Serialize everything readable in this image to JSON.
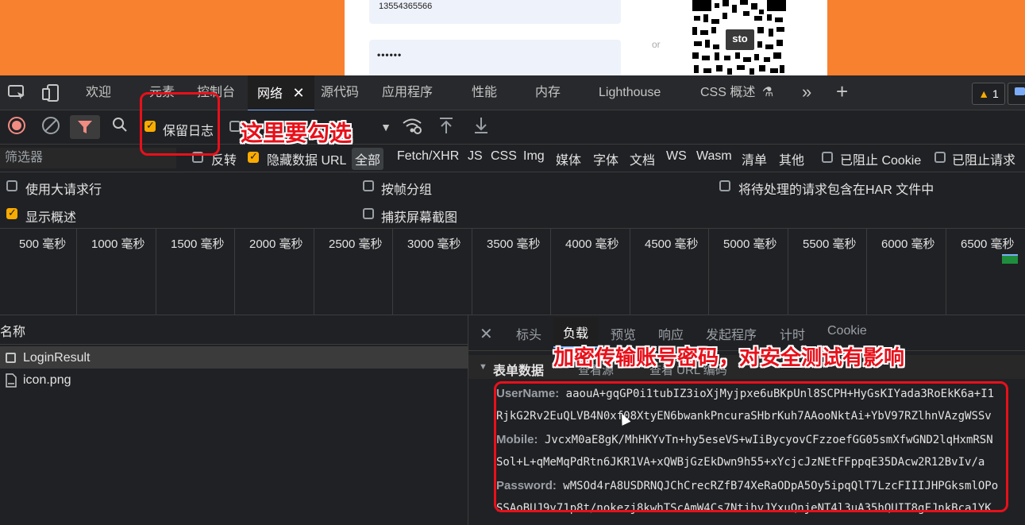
{
  "page": {
    "phone_value": "13554365566",
    "password_mask": "••••••",
    "or_label": "or",
    "logo_text": "sto"
  },
  "tabs": [
    {
      "label": "欢迎"
    },
    {
      "label": "元素"
    },
    {
      "label": "控制台"
    },
    {
      "label": "网络",
      "active": true
    },
    {
      "label": "源代码"
    },
    {
      "label": "应用程序"
    },
    {
      "label": "性能"
    },
    {
      "label": "内存"
    },
    {
      "label": "Lighthouse"
    },
    {
      "label": "CSS 概述"
    }
  ],
  "warning_count": "1",
  "toolbar": {
    "preserve_log_label": "保留日志",
    "preserve_log_checked": true
  },
  "filter": {
    "placeholder": "筛选器",
    "invert_label": "反转",
    "hide_data_url_label": "隐藏数据 URL",
    "hide_data_url_checked": true,
    "types": [
      "全部",
      "Fetch/XHR",
      "JS",
      "CSS",
      "Img",
      "媒体",
      "字体",
      "文档",
      "WS",
      "Wasm",
      "清单",
      "其他"
    ],
    "active_type": "全部",
    "blocked_cookies_label": "已阻止 Cookie",
    "blocked_requests_label": "已阻止请求"
  },
  "options": {
    "large_rows": "使用大请求行",
    "group_by_frame": "按帧分组",
    "har_pending": "将待处理的请求包含在HAR 文件中",
    "show_overview": "显示概述",
    "show_overview_checked": true,
    "capture_screenshots": "捕获屏幕截图"
  },
  "timeline": {
    "ticks": [
      "500 毫秒",
      "1000 毫秒",
      "1500 毫秒",
      "2000 毫秒",
      "2500 毫秒",
      "3000 毫秒",
      "3500 毫秒",
      "4000 毫秒",
      "4500 毫秒",
      "5000 毫秒",
      "5500 毫秒",
      "6000 毫秒",
      "6500 毫秒"
    ]
  },
  "requests": {
    "header": "名称",
    "items": [
      {
        "name": "LoginResult",
        "selected": true
      },
      {
        "name": "icon.png",
        "selected": false
      }
    ]
  },
  "details": {
    "tabs": [
      "标头",
      "负载",
      "预览",
      "响应",
      "发起程序",
      "计时",
      "Cookie"
    ],
    "active_tab": "负载",
    "section_title": "表单数据",
    "view_source": "查看源",
    "view_url_encoded": "查看 URL 编码",
    "fields": [
      {
        "key": "UserName:",
        "value": "aaouA+gqGP0i1tubIZ3ioXjMyjpxe6uBKpUnl8SCPH+HyGsKIYada3RoEkK6a+I1"
      },
      {
        "key": "",
        "value": "RjkG2Rv2EuQLVB4N0xf08XtyEN6bwankPncuraSHbrKuh7AAooNktAi+YbV97RZlhnVAzgWSSv"
      },
      {
        "key": "Mobile:",
        "value": "JvcxM0aE8gK/MhHKYvTn+hy5eseVS+wIiBycyovCFzzoefGG05smXfwGND2lqHxmRSN"
      },
      {
        "key": "",
        "value": "Sol+L+qMeMqPdRtn6JKR1VA+xQWBjGzEkDwn9h55+xYcjcJzNEtFFppqE35DAcw2R12BvIv/a"
      },
      {
        "key": "Password:",
        "value": "wMSOd4rA8USDRNQJChCrecRZfB74XeRaODpA5Oy5ipqQlT7LzcFIIIJHPGksmlOPo"
      },
      {
        "key": "",
        "value": "SSAoBUJ9v71p8t/nokezj8kwhTScAmW4Cs7NtihvJYxuQnjeNT4l3uA35hQUIT8gFJnkBca1YK"
      }
    ]
  },
  "annotations": {
    "check_note": "这里要勾选",
    "security_note": "加密传输账号密码，对安全测试有影响"
  }
}
